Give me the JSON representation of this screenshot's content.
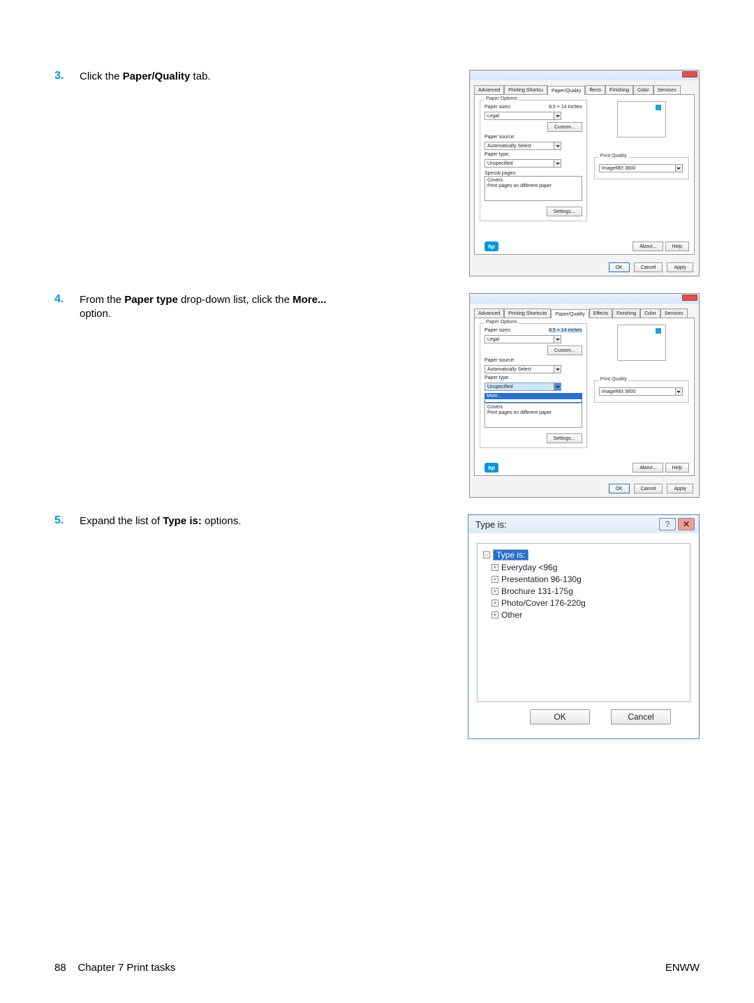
{
  "steps": {
    "3": {
      "num": "3.",
      "pre": "Click the ",
      "b": "Paper/Quality",
      "post": " tab."
    },
    "4": {
      "num": "4.",
      "pre": "From the ",
      "b1": "Paper type",
      "mid": " drop-down list, click the ",
      "b2": "More...",
      "post": " option."
    },
    "5": {
      "num": "5.",
      "pre": "Expand the list of ",
      "b": "Type is:",
      "post": " options."
    }
  },
  "tabs": [
    "Advanced",
    "Printing Shortcu",
    "Paper/Quality",
    "ffects",
    "Finishing",
    "Color",
    "Services"
  ],
  "tabs2": [
    "Advanced",
    "Printing Shortcuts",
    "Paper/Quality",
    "Effects",
    "Finishing",
    "Color",
    "Services"
  ],
  "pq": {
    "paper_options": "Paper Options",
    "paper_sizes": "Paper sizes:",
    "size_dim": "8.5 × 14 inches",
    "size_val": "Legal",
    "custom": "Custom...",
    "paper_source": "Paper source:",
    "source_val": "Automatically Select",
    "paper_type": "Paper type:",
    "type_val": "Unspecified",
    "more": "More...",
    "special": "Special pages:",
    "covers": "Covers",
    "diff": "Print pages on different paper",
    "settings": "Settings...",
    "print_quality": "Print Quality",
    "pq_val": "ImageREt 3600",
    "about": "About...",
    "help": "Help",
    "ok": "OK",
    "cancel": "Cancel",
    "apply": "Apply"
  },
  "typeis": {
    "title": "Type is:",
    "root": "Type is:",
    "items": [
      "Everyday <96g",
      "Presentation 96-130g",
      "Brochure 131-175g",
      "Photo/Cover 176-220g",
      "Other"
    ],
    "ok": "OK",
    "cancel": "Cancel"
  },
  "footer": {
    "left_page": "88",
    "left_chap": "Chapter 7   Print tasks",
    "right": "ENWW"
  }
}
